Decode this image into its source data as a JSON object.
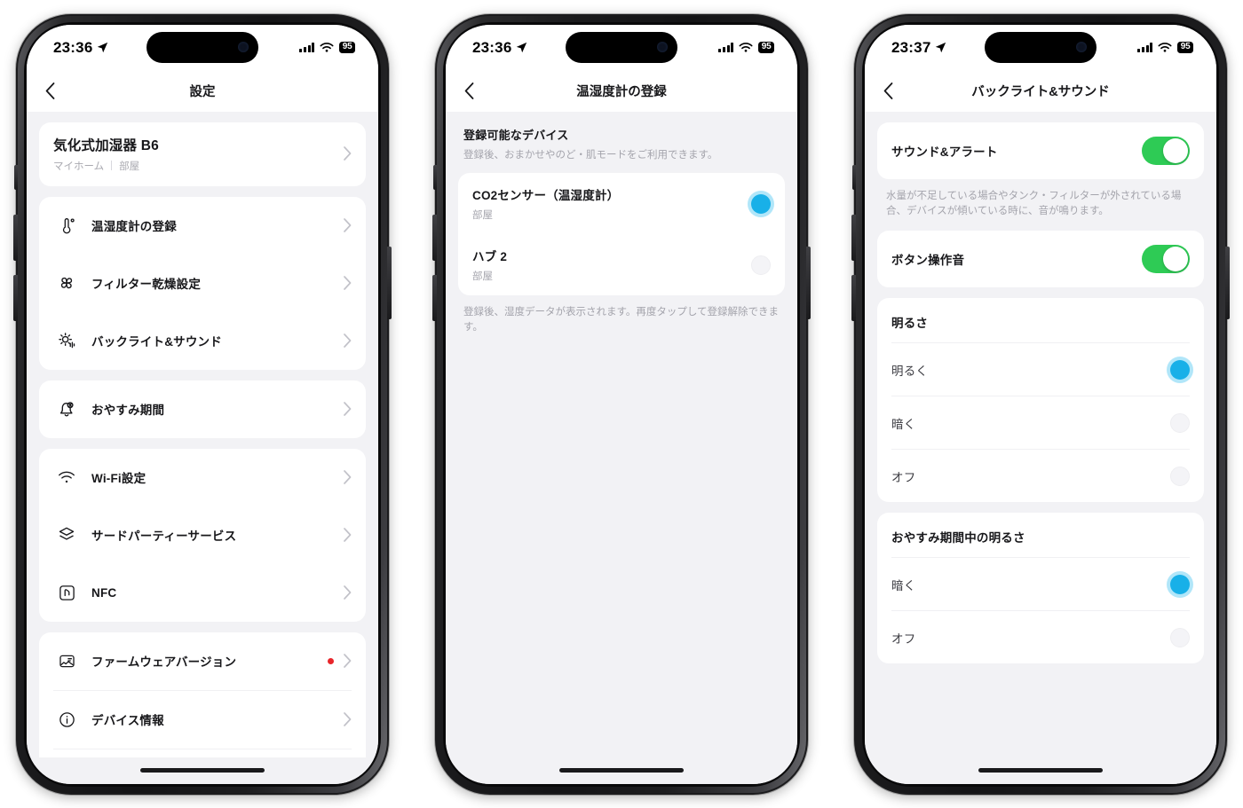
{
  "theme": {
    "accent_blue": "#18b0e8",
    "toggle_green": "#2ecb55",
    "badge_red": "#e8252a",
    "screen_bg": "#f2f2f5",
    "card_bg": "#ffffff"
  },
  "phones": [
    {
      "status_bar": {
        "time": "23:36",
        "battery": "95",
        "location_icon": "location-arrow-icon",
        "signal_icon": "cellular-bars-icon",
        "wifi_icon": "wifi-icon"
      },
      "nav": {
        "back_icon": "chevron-left-icon",
        "title": "設定"
      },
      "device_card": {
        "name": "気化式加湿器 B6",
        "home": "マイホーム",
        "room": "部屋",
        "chevron": "chevron-right-icon"
      },
      "groups": [
        {
          "items": [
            {
              "label": "温湿度計の登録",
              "icon": "thermometer-icon"
            },
            {
              "label": "フィルター乾燥設定",
              "icon": "fan-icon"
            },
            {
              "label": "バックライト&サウンド",
              "icon": "brightness-sound-icon"
            }
          ]
        },
        {
          "items": [
            {
              "label": "おやすみ期間",
              "icon": "bell-sleep-icon"
            }
          ]
        },
        {
          "items": [
            {
              "label": "Wi-Fi設定",
              "icon": "wifi-icon"
            },
            {
              "label": "サードパーティーサービス",
              "icon": "layers-icon"
            },
            {
              "label": "NFC",
              "icon": "nfc-icon"
            }
          ]
        },
        {
          "items": [
            {
              "label": "ファームウェアバージョン",
              "icon": "firmware-icon",
              "badge": true
            },
            {
              "label": "デバイス情報",
              "icon": "info-circle-icon"
            }
          ]
        }
      ]
    },
    {
      "status_bar": {
        "time": "23:36",
        "battery": "95",
        "location_icon": "location-arrow-icon",
        "signal_icon": "cellular-bars-icon",
        "wifi_icon": "wifi-icon"
      },
      "nav": {
        "back_icon": "chevron-left-icon",
        "title": "温湿度計の登録"
      },
      "section": {
        "title": "登録可能なデバイス",
        "description": "登録後、おまかせやのど・肌モードをご利用できます。",
        "footer": "登録後、湿度データが表示されます。再度タップして登録解除できます。"
      },
      "devices": [
        {
          "name": "CO2センサー（温湿度計）",
          "room": "部屋",
          "selected": true
        },
        {
          "name": "ハブ 2",
          "room": "部屋",
          "selected": false
        }
      ]
    },
    {
      "status_bar": {
        "time": "23:37",
        "battery": "95",
        "location_icon": "location-arrow-icon",
        "signal_icon": "cellular-bars-icon",
        "wifi_icon": "wifi-icon"
      },
      "nav": {
        "back_icon": "chevron-left-icon",
        "title": "バックライト&サウンド"
      },
      "sound_alert": {
        "label": "サウンド&アラート",
        "enabled": true
      },
      "sound_note": "水量が不足している場合やタンク・フィルターが外されている場合、デバイスが傾いている時に、音が鳴ります。",
      "button_tone": {
        "label": "ボタン操作音",
        "enabled": true
      },
      "brightness": {
        "title": "明るさ",
        "options": [
          {
            "label": "明るく",
            "selected": true
          },
          {
            "label": "暗く",
            "selected": false
          },
          {
            "label": "オフ",
            "selected": false
          }
        ]
      },
      "sleep_brightness": {
        "title": "おやすみ期間中の明るさ",
        "options": [
          {
            "label": "暗く",
            "selected": true
          },
          {
            "label": "オフ",
            "selected": false
          }
        ]
      }
    }
  ]
}
